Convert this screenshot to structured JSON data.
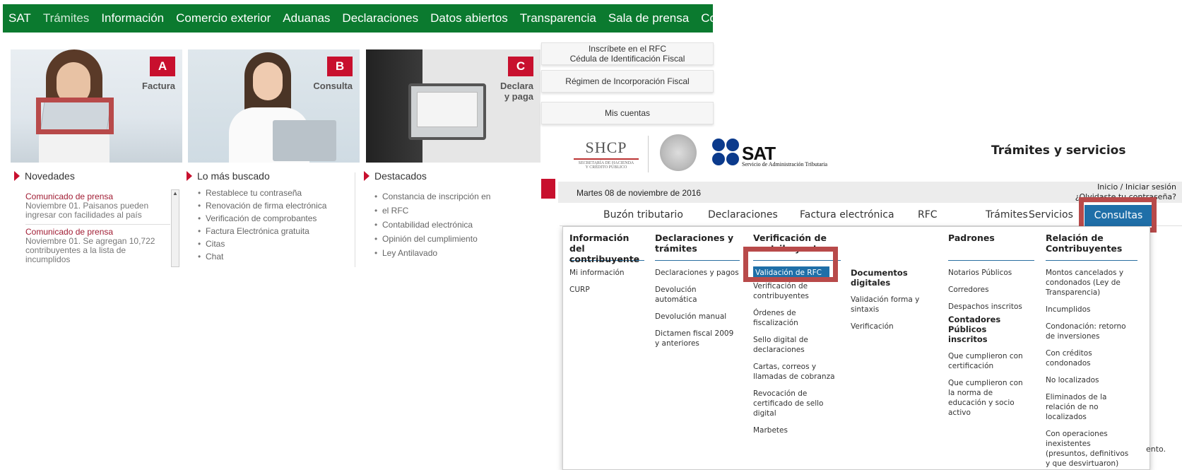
{
  "top_nav": [
    "SAT",
    "Trámites",
    "Información",
    "Comercio exterior",
    "Aduanas",
    "Declaraciones",
    "Datos abiertos",
    "Transparencia",
    "Sala de prensa",
    "Contacto"
  ],
  "heroes": [
    {
      "badge": "A",
      "caption": "Factura"
    },
    {
      "badge": "B",
      "caption": "Consulta"
    },
    {
      "badge": "C",
      "caption_l1": "Declara",
      "caption_l2": "y paga"
    }
  ],
  "side_buttons": {
    "rfc_l1": "Inscríbete en el RFC",
    "rfc_l2": "Cédula de Identificación Fiscal",
    "rif": "Régimen de Incorporación Fiscal",
    "cuentas": "Mis cuentas"
  },
  "novedades": {
    "title": "Novedades",
    "items": [
      {
        "title": "Comunicado de prensa",
        "l1": "Noviembre 01. Paisanos pueden",
        "l2": "ingresar con facilidades al país"
      },
      {
        "title": "Comunicado de prensa",
        "l1": "Noviembre 01. Se agregan 10,722",
        "l2": "contribuyentes a la lista de",
        "l3": "incumplidos"
      }
    ]
  },
  "mas_buscado": {
    "title": "Lo más buscado",
    "items": [
      "Restablece tu contraseña",
      "Renovación de firma electrónica",
      "Verificación de comprobantes",
      "Factura Electrónica gratuita",
      "Citas",
      "Chat"
    ]
  },
  "destacados": {
    "title": "Destacados",
    "items": [
      "Constancia de inscripción en",
      "el RFC",
      "Contabilidad electrónica",
      "Opinión del cumplimiento",
      "Ley Antilavado"
    ]
  },
  "header": {
    "shcp": "SHCP",
    "shcp_sub1": "SECRETARÍA DE HACIENDA",
    "shcp_sub2": "Y CRÉDITO PÚBLICO",
    "sat": "SAT",
    "sat_sub": "Servicio de Administración Tributaria",
    "section_title": "Trámites y servicios",
    "date": "Martes 08 de noviembre de 2016",
    "login": "Inicio / Iniciar sesión",
    "forgot": "¿Olvidaste tu contraseña?"
  },
  "menu": [
    "Buzón tributario",
    "Declaraciones",
    "Factura electrónica",
    "RFC",
    "Trámites",
    "Servicios",
    "Consultas"
  ],
  "dropdown": {
    "col1": {
      "h1": "Información del",
      "h2": "contribuyente",
      "items": [
        "Mi información",
        "CURP"
      ]
    },
    "col2": {
      "h1": "Declaraciones y",
      "h2": "trámites",
      "items": [
        "Declaraciones y pagos",
        "Devolución automática",
        "Devolución manual",
        "Dictamen fiscal 2009 y anteriores"
      ]
    },
    "col3": {
      "h1": "Verificación de",
      "h2": "contribuyentes",
      "selected": "Validación de RFC",
      "items": [
        "Verificación de contribuyentes",
        "Órdenes de fiscalización",
        "Sello digital de declaraciones",
        "Cartas, correos y llamadas de cobranza",
        "Revocación de certificado de sello digital",
        "Marbetes"
      ]
    },
    "col4": {
      "sub": "Documentos digitales",
      "items": [
        "Validación forma y sintaxis",
        "Verificación"
      ]
    },
    "col5": {
      "h1": "Padrones",
      "items": [
        "Notarios Públicos",
        "Corredores",
        "Despachos inscritos"
      ],
      "sub": "Contadores Públicos inscritos",
      "items2": [
        "Que cumplieron con certificación",
        "Que cumplieron con la norma de educación y socio activo"
      ]
    },
    "col6": {
      "h1": "Relación de",
      "h2": "Contribuyentes",
      "items": [
        "Montos cancelados y condonados (Ley de Transparencia)",
        "Incumplidos",
        "Condonación: retorno de inversiones",
        "Con créditos condonados",
        "No localizados",
        "Eliminados de la relación de no localizados",
        "Con operaciones inexistentes (presuntos, definitivos y que desvirtuaron)"
      ]
    }
  },
  "right_edge_fragment": "ento.",
  "colors": {
    "green": "#0b7a2f",
    "red": "#c8102e",
    "highlight": "#b84a4a",
    "blue": "#1f6fa8"
  }
}
